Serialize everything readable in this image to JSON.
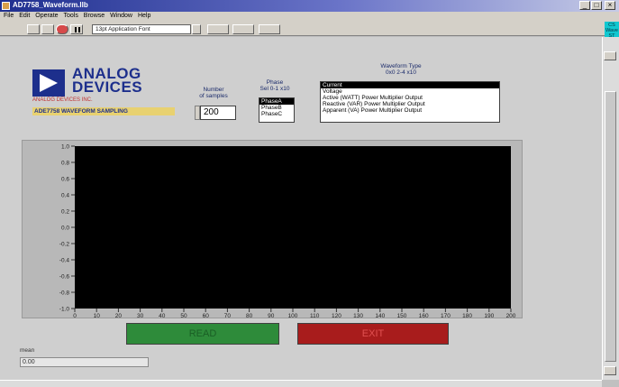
{
  "window": {
    "title": "AD7758_Waveform.llb"
  },
  "menu": {
    "items": [
      "File",
      "Edit",
      "Operate",
      "Tools",
      "Browse",
      "Window",
      "Help"
    ]
  },
  "toolbar": {
    "font_select": "13pt Application Font",
    "run_badge": "CS Wave ST"
  },
  "logo": {
    "line1": "ANALOG",
    "line2": "DEVICES",
    "tagline": "ANALOG DEVICES INC."
  },
  "sampling_label": "ADE7758 WAVEFORM SAMPLING",
  "samples": {
    "label_line1": "Number",
    "label_line2": "of samples",
    "value": "200"
  },
  "phase": {
    "label_line1": "Phase",
    "label_line2": "Sel 0-1 x10",
    "options": [
      "PhaseA",
      "PhaseB",
      "PhaseC"
    ],
    "selected": 0
  },
  "waveform": {
    "label_line1": "Waveform Type",
    "label_line2": "0x0 2-4 x10",
    "options": [
      "Current",
      "Voltage",
      "Active (WATT) Power Multiplier Output",
      "Reactive (VAR) Power Multiplier Output",
      "Apparent (VA) Power Multiplier Output"
    ],
    "selected": 0
  },
  "chart_data": {
    "type": "line",
    "title": "",
    "xlabel": "",
    "ylabel": "",
    "xlim": [
      0,
      200
    ],
    "ylim": [
      -1.0,
      1.0
    ],
    "x_ticks": [
      "0",
      "10",
      "20",
      "30",
      "40",
      "50",
      "60",
      "70",
      "80",
      "90",
      "100",
      "110",
      "120",
      "130",
      "140",
      "150",
      "160",
      "170",
      "180",
      "190",
      "200"
    ],
    "y_ticks": [
      "1.0",
      "0.8",
      "0.6",
      "0.4",
      "0.2",
      "0.0",
      "-0.2",
      "-0.4",
      "-0.6",
      "-0.8",
      "-1.0"
    ],
    "series": [],
    "plot_background": "#000000"
  },
  "buttons": {
    "read": "READ",
    "exit": "EXIT",
    "read_color": "#2e8b3a",
    "exit_color": "#a81c1c"
  },
  "mean": {
    "label": "mean",
    "value": "0.00"
  },
  "window_buttons": {
    "minimize": "_",
    "maximize": "□",
    "close": "×"
  }
}
